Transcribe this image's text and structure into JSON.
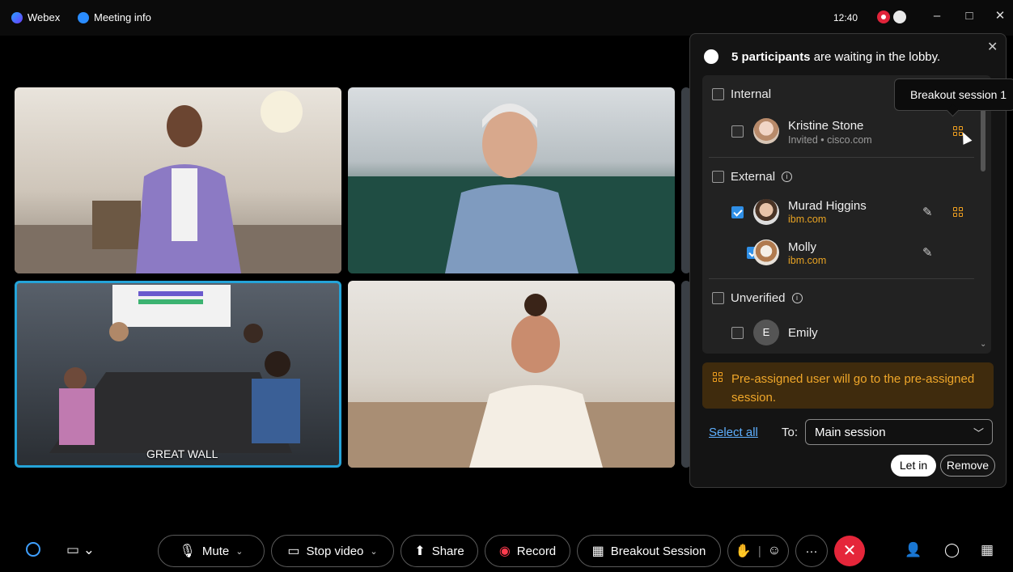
{
  "titlebar": {
    "app_name": "Webex",
    "meeting_info": "Meeting info",
    "clock": "12:40"
  },
  "tiles": {
    "room_label": "GREAT WALL"
  },
  "lobby": {
    "header_count": "5 participants",
    "header_rest": " are waiting in the lobby.",
    "tooltip": "Breakout session 1",
    "groups": {
      "internal": "Internal",
      "external": "External",
      "unverified": "Unverified"
    },
    "participants": [
      {
        "name": "Kristine Stone",
        "sub": "Invited • cisco.com",
        "checked": false
      },
      {
        "name": "Murad Higgins",
        "sub": "ibm.com",
        "checked": true
      },
      {
        "name": "Molly",
        "sub": "ibm.com",
        "checked": true
      },
      {
        "name": "Emily",
        "initial": "E",
        "checked": false
      }
    ],
    "notice": "Pre-assigned user will go to the pre-assigned session.",
    "select_all": "Select all",
    "to_label": "To:",
    "destination": "Main session",
    "let_in": "Let in",
    "remove": "Remove"
  },
  "controls": {
    "mute": "Mute",
    "stop_video": "Stop video",
    "share": "Share",
    "record": "Record",
    "breakout": "Breakout Session",
    "more": "···"
  },
  "colors": {
    "accent_blue": "#2f8fe6",
    "orange": "#f0a020",
    "end_call": "#e5263a",
    "selected_tile_border": "#24a3d8"
  }
}
